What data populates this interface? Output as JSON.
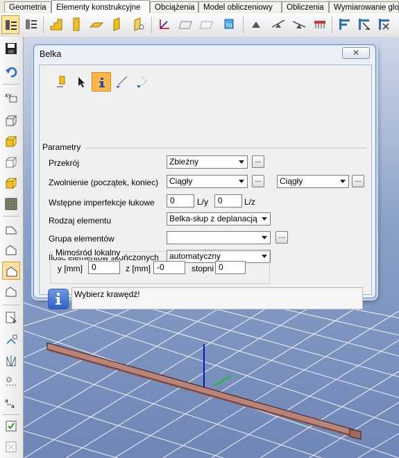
{
  "tabs": [
    {
      "label": "Geometria",
      "active": false
    },
    {
      "label": "Elementy konstrukcyjne",
      "active": true
    },
    {
      "label": "Obciążenia",
      "active": false
    },
    {
      "label": "Model obliczeniowy",
      "active": false
    },
    {
      "label": "Obliczenia",
      "active": false
    },
    {
      "label": "Wymiarowanie glo",
      "active": false
    }
  ],
  "dialog": {
    "title": "Belka",
    "close_glyph": "✕",
    "section_title": "Parametry",
    "modes": [
      "beam-icon",
      "pointer-icon",
      "info-icon",
      "select-line-icon",
      "select-chain-icon"
    ],
    "fields": {
      "przekroj": {
        "label": "Przekrój",
        "value": "Zbieżny"
      },
      "zwolnienie": {
        "label": "Zwolnienie (początek, koniec)",
        "start": "Ciągły",
        "end": "Ciągły"
      },
      "imperfekcje": {
        "label": "Wstępne imperfekcje łukowe",
        "ly_value": "0",
        "ly_unit": "L/y",
        "lz_value": "0",
        "lz_unit": "L/z"
      },
      "rodzaj": {
        "label": "Rodzaj elementu",
        "value": "Belka-słup z deplanacją"
      },
      "grupa": {
        "label": "Grupa elementów",
        "value": ""
      },
      "ilosc": {
        "label": "Ilość elementów skończonych",
        "value": "automatyczny"
      }
    },
    "dots_label": "...",
    "eccentricity": {
      "title": "Mimośród lokalny",
      "y_label": "y [mm]",
      "y_value": "0",
      "z_label": "z [mm]",
      "z_value": "-0",
      "deg_label": "stopni",
      "deg_value": "0"
    },
    "message": "Wybierz krawędź!"
  },
  "colors": {
    "accent_selected": "#ffb74a",
    "beam": "#b98378",
    "grid": "#ffffff",
    "axis_z": "#1010c8",
    "axis_y": "#10c820"
  }
}
